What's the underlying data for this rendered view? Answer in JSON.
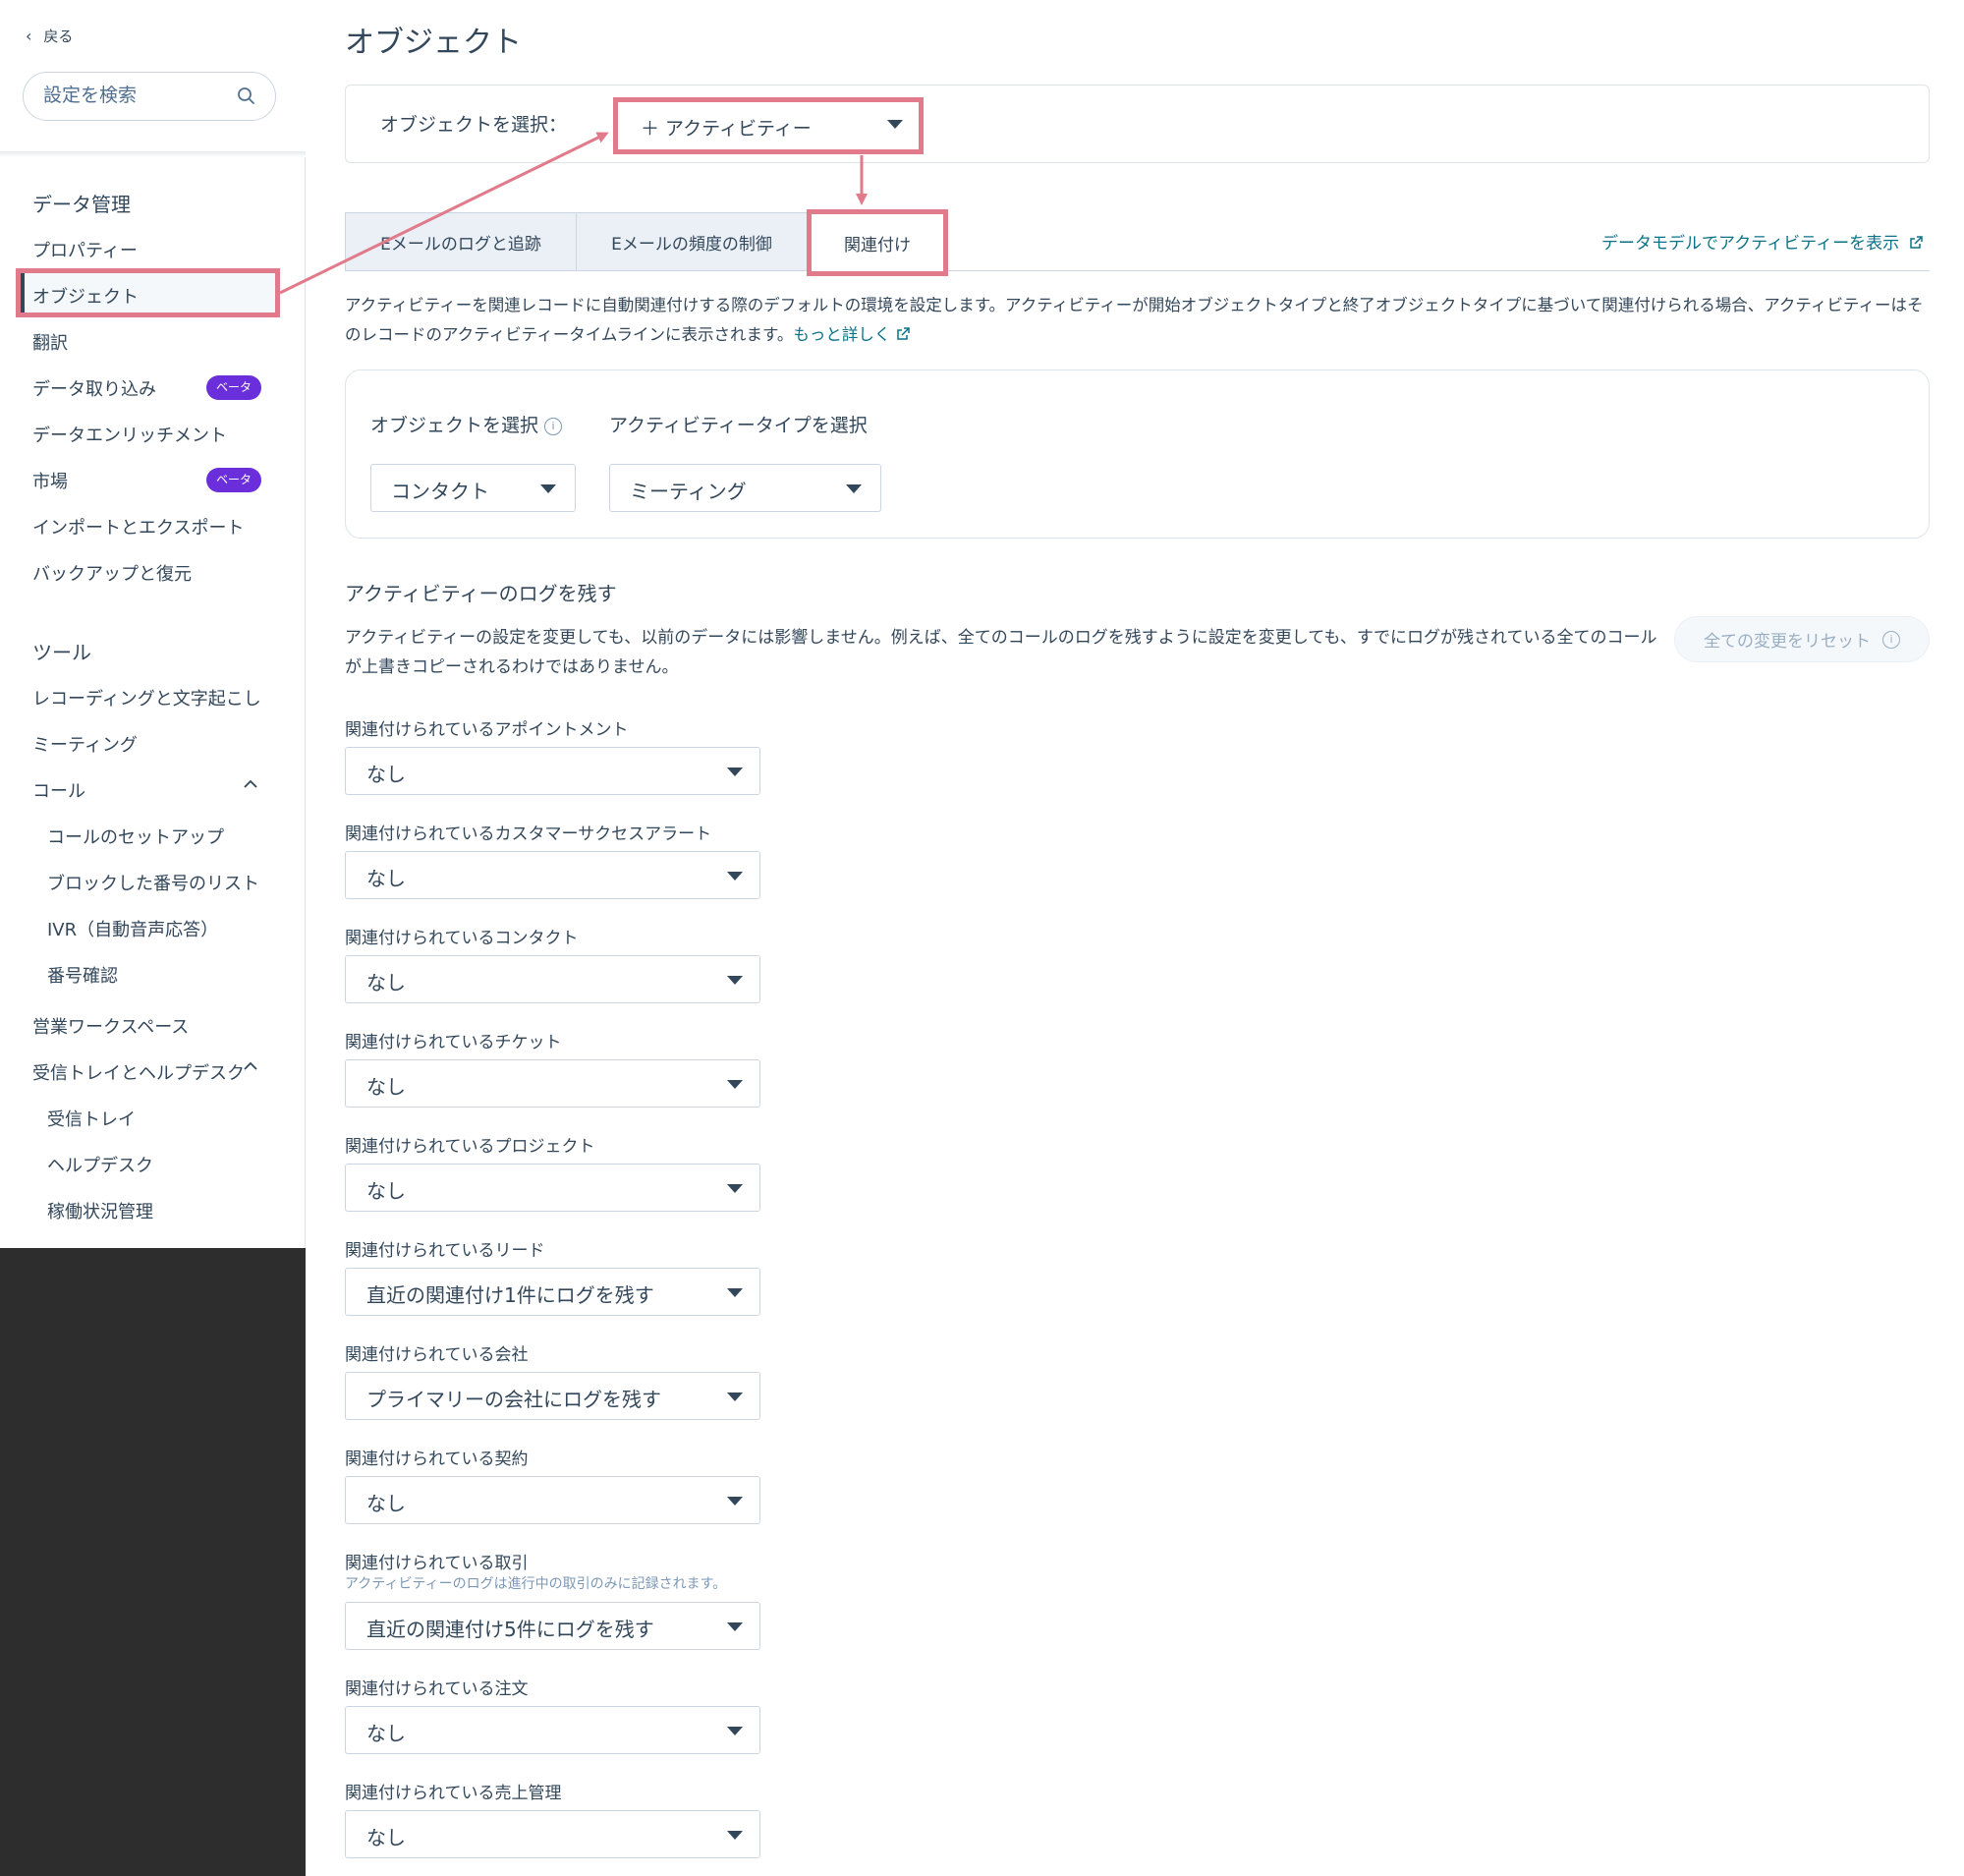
{
  "sidebar": {
    "back_label": "戻る",
    "search_placeholder": "設定を検索",
    "sections": [
      {
        "heading": "データ管理",
        "items": [
          {
            "label": "プロパティー"
          },
          {
            "label": "オブジェクト",
            "active": true
          },
          {
            "label": "翻訳"
          },
          {
            "label": "データ取り込み",
            "badge": "ベータ"
          },
          {
            "label": "データエンリッチメント"
          },
          {
            "label": "市場",
            "badge": "ベータ"
          },
          {
            "label": "インポートとエクスポート"
          },
          {
            "label": "バックアップと復元"
          }
        ]
      },
      {
        "heading": "ツール",
        "items": [
          {
            "label": "レコーディングと文字起こし"
          },
          {
            "label": "ミーティング"
          },
          {
            "label": "コール",
            "expanded": true,
            "children": [
              "コールのセットアップ",
              "ブロックした番号のリスト",
              "IVR（自動音声応答）",
              "番号確認"
            ]
          },
          {
            "label": "営業ワークスペース"
          },
          {
            "label": "受信トレイとヘルプデスク",
            "expanded": true,
            "children": [
              "受信トレイ",
              "ヘルプデスク",
              "稼働状況管理"
            ]
          }
        ]
      }
    ]
  },
  "main": {
    "title": "オブジェクト",
    "object_select": {
      "label": "オブジェクトを選択：",
      "value": "＋ アクティビティー"
    },
    "tabs": [
      {
        "label": "Eメールのログと追跡"
      },
      {
        "label": "Eメールの頻度の制御"
      },
      {
        "label": "関連付け",
        "active": true
      }
    ],
    "data_model_link": "データモデルでアクティビティーを表示",
    "description": "アクティビティーを関連レコードに自動関連付けする際のデフォルトの環境を設定します。アクティビティーが開始オブジェクトタイプと終了オブジェクトタイプに基づいて関連付けられる場合、アクティビティーはそのレコードのアクティビティータイムラインに表示されます。",
    "learn_more": "もっと詳しく",
    "filters": {
      "object_label": "オブジェクトを選択",
      "object_value": "コンタクト",
      "type_label": "アクティビティータイプを選択",
      "type_value": "ミーティング"
    },
    "log_section": {
      "title": "アクティビティーのログを残す",
      "description": "アクティビティーの設定を変更しても、以前のデータには影響しません。例えば、全てのコールのログを残すように設定を変更しても、すでにログが残されている全てのコールが上書きコピーされるわけではありません。",
      "reset_label": "全ての変更をリセット"
    },
    "associations": [
      {
        "label": "関連付けられているアポイントメント",
        "value": "なし"
      },
      {
        "label": "関連付けられているカスタマーサクセスアラート",
        "value": "なし"
      },
      {
        "label": "関連付けられているコンタクト",
        "value": "なし"
      },
      {
        "label": "関連付けられているチケット",
        "value": "なし"
      },
      {
        "label": "関連付けられているプロジェクト",
        "value": "なし"
      },
      {
        "label": "関連付けられているリード",
        "value": "直近の関連付け1件にログを残す"
      },
      {
        "label": "関連付けられている会社",
        "value": "プライマリーの会社にログを残す"
      },
      {
        "label": "関連付けられている契約",
        "value": "なし"
      },
      {
        "label": "関連付けられている取引",
        "help": "アクティビティーのログは進行中の取引のみに記録されます。",
        "value": "直近の関連付け5件にログを残す"
      },
      {
        "label": "関連付けられている注文",
        "value": "なし"
      },
      {
        "label": "関連付けられている売上管理",
        "value": "なし"
      }
    ]
  },
  "colors": {
    "highlight": "#e17a8a",
    "badge": "#6a2fdb",
    "link": "#0b7287",
    "text": "#33475b"
  }
}
